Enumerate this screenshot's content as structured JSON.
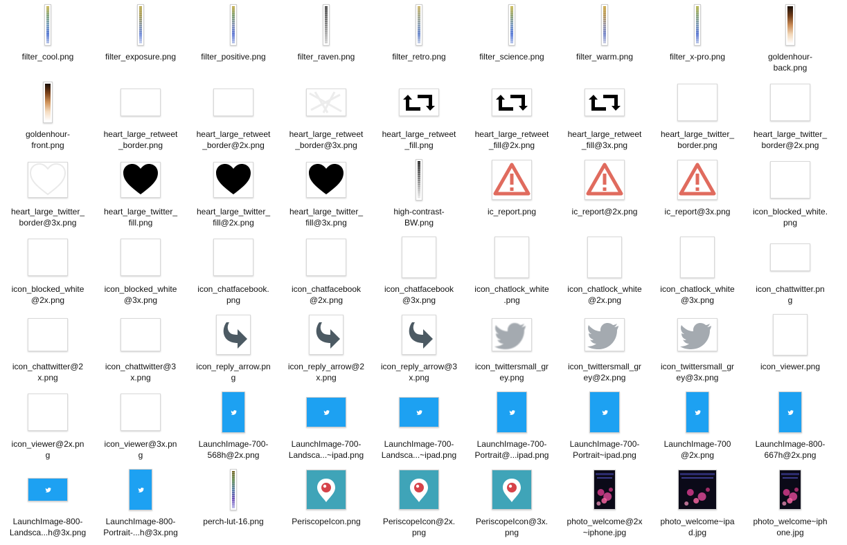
{
  "files": [
    {
      "name": "filter_cool.png",
      "kind": "strip",
      "colors": [
        "#c9b24a",
        "#7fa37a",
        "#7a9fc0",
        "#4a6fd0",
        "#b6c4e6"
      ]
    },
    {
      "name": "filter_exposure.png",
      "kind": "strip",
      "colors": [
        "#b8a64a",
        "#a69a55",
        "#8c9aa5",
        "#6a86d8",
        "#c6d1ee"
      ]
    },
    {
      "name": "filter_positive.png",
      "kind": "strip",
      "colors": [
        "#c2a640",
        "#7a9d6e",
        "#8a96b8",
        "#5670d2",
        "#b9c6e9"
      ]
    },
    {
      "name": "filter_raven.png",
      "kind": "strip",
      "colors": [
        "#444444",
        "#666666",
        "#888888",
        "#aaaaaa",
        "#d2d2d2"
      ]
    },
    {
      "name": "filter_retro.png",
      "kind": "strip",
      "colors": [
        "#c8b060",
        "#a4a78a",
        "#8fa2b6",
        "#6080c9",
        "#c9d3e7"
      ]
    },
    {
      "name": "filter_science.png",
      "kind": "strip",
      "colors": [
        "#c7b54b",
        "#8ea272",
        "#7d9bc2",
        "#4e72d6",
        "#b7c6ea"
      ]
    },
    {
      "name": "filter_warm.png",
      "kind": "strip",
      "colors": [
        "#c9a33e",
        "#b59455",
        "#9c98a8",
        "#6e7fc6",
        "#cbcfe2"
      ]
    },
    {
      "name": "filter_x-pro.png",
      "kind": "strip",
      "colors": [
        "#b2b040",
        "#86a27a",
        "#7e9ab8",
        "#506fd0",
        "#bac6e7"
      ]
    },
    {
      "name": "goldenhour-\nback.png",
      "kind": "goldstrip",
      "colors": [
        "#1a0f08",
        "#6d3a18",
        "#c88a55",
        "#f2d7b8",
        "#ffffff"
      ]
    },
    {
      "name": "goldenhour-\nfront.png",
      "kind": "goldstrip",
      "colors": [
        "#1a0f08",
        "#7a4119",
        "#d0935a",
        "#f5dcc0",
        "#ffffff"
      ]
    },
    {
      "name": "heart_large_retweet\n_border.png",
      "kind": "blank-wide"
    },
    {
      "name": "heart_large_retweet\n_border@2x.png",
      "kind": "blank-wide"
    },
    {
      "name": "heart_large_retweet\n_border@3x.png",
      "kind": "faint-wide"
    },
    {
      "name": "heart_large_retweet\n_fill.png",
      "kind": "retweet"
    },
    {
      "name": "heart_large_retweet\n_fill@2x.png",
      "kind": "retweet"
    },
    {
      "name": "heart_large_retweet\n_fill@3x.png",
      "kind": "retweet"
    },
    {
      "name": "heart_large_twitter_\nborder.png",
      "kind": "blank-square"
    },
    {
      "name": "heart_large_twitter_\nborder@2x.png",
      "kind": "blank-square"
    },
    {
      "name": "heart_large_twitter_\nborder@3x.png",
      "kind": "heart-outline"
    },
    {
      "name": "heart_large_twitter_\nfill.png",
      "kind": "heart"
    },
    {
      "name": "heart_large_twitter_\nfill@2x.png",
      "kind": "heart"
    },
    {
      "name": "heart_large_twitter_\nfill@3x.png",
      "kind": "heart"
    },
    {
      "name": "high-contrast-\nBW.png",
      "kind": "strip",
      "colors": [
        "#222222",
        "#555555",
        "#888888",
        "#bbbbbb",
        "#eeeeee"
      ]
    },
    {
      "name": "ic_report.png",
      "kind": "warning"
    },
    {
      "name": "ic_report@2x.png",
      "kind": "warning"
    },
    {
      "name": "ic_report@3x.png",
      "kind": "warning"
    },
    {
      "name": "icon_blocked_white.\npng",
      "kind": "blank-square"
    },
    {
      "name": "icon_blocked_white\n@2x.png",
      "kind": "blank-square"
    },
    {
      "name": "icon_blocked_white\n@3x.png",
      "kind": "blank-square"
    },
    {
      "name": "icon_chatfacebook.\npng",
      "kind": "blank-square"
    },
    {
      "name": "icon_chatfacebook\n@2x.png",
      "kind": "blank-square"
    },
    {
      "name": "icon_chatfacebook\n@3x.png",
      "kind": "blank-tall"
    },
    {
      "name": "icon_chatlock_white\n.png",
      "kind": "blank-tall"
    },
    {
      "name": "icon_chatlock_white\n@2x.png",
      "kind": "blank-tall"
    },
    {
      "name": "icon_chatlock_white\n@3x.png",
      "kind": "blank-tall"
    },
    {
      "name": "icon_chattwitter.pn\ng",
      "kind": "blank-wide"
    },
    {
      "name": "icon_chattwitter@2\nx.png",
      "kind": "blank-square-sm"
    },
    {
      "name": "icon_chattwitter@3\nx.png",
      "kind": "blank-square-sm"
    },
    {
      "name": "icon_reply_arrow.pn\ng",
      "kind": "reply"
    },
    {
      "name": "icon_reply_arrow@2\nx.png",
      "kind": "reply"
    },
    {
      "name": "icon_reply_arrow@3\nx.png",
      "kind": "reply"
    },
    {
      "name": "icon_twittersmall_gr\ney.png",
      "kind": "bird-pixel"
    },
    {
      "name": "icon_twittersmall_gr\ney@2x.png",
      "kind": "bird"
    },
    {
      "name": "icon_twittersmall_gr\ney@3x.png",
      "kind": "bird"
    },
    {
      "name": "icon_viewer.png",
      "kind": "blank-tall"
    },
    {
      "name": "icon_viewer@2x.pn\ng",
      "kind": "blank-square"
    },
    {
      "name": "icon_viewer@3x.pn\ng",
      "kind": "blank-square"
    },
    {
      "name": "LaunchImage-700-\n568h@2x.png",
      "kind": "launch-tall"
    },
    {
      "name": "LaunchImage-700-\nLandsca...~ipad.png",
      "kind": "launch-wide"
    },
    {
      "name": "LaunchImage-700-\nLandsca...~ipad.png",
      "kind": "launch-wide"
    },
    {
      "name": "LaunchImage-700-\nPortrait@...ipad.png",
      "kind": "launch-portrait"
    },
    {
      "name": "LaunchImage-700-\nPortrait~ipad.png",
      "kind": "launch-portrait"
    },
    {
      "name": "LaunchImage-700\n@2x.png",
      "kind": "launch-tall"
    },
    {
      "name": "LaunchImage-800-\n667h@2x.png",
      "kind": "launch-tall"
    },
    {
      "name": "LaunchImage-800-\nLandsca...h@3x.png",
      "kind": "launch-wide-sm"
    },
    {
      "name": "LaunchImage-800-\nPortrait-...h@3x.png",
      "kind": "launch-tall"
    },
    {
      "name": "perch-lut-16.png",
      "kind": "strip",
      "colors": [
        "#7a6a2a",
        "#5f8a52",
        "#5a7fa8",
        "#6d50b8",
        "#b9b9e9"
      ]
    },
    {
      "name": "PeriscopeIcon.png",
      "kind": "periscope"
    },
    {
      "name": "PeriscopeIcon@2x.\npng",
      "kind": "periscope"
    },
    {
      "name": "PeriscopeIcon@3x.\npng",
      "kind": "periscope"
    },
    {
      "name": "photo_welcome@2x\n~iphone.jpg",
      "kind": "photo-tall"
    },
    {
      "name": "photo_welcome~ipa\nd.jpg",
      "kind": "photo-wide"
    },
    {
      "name": "photo_welcome~iph\none.jpg",
      "kind": "photo-tall"
    }
  ],
  "colors": {
    "twitter_blue": "#1da1f2",
    "report_red": "#e06b5e",
    "reply_grey": "#4c5a63",
    "bird_grey": "#a4aab0",
    "periscope_teal": "#3fa4b8",
    "periscope_red": "#d6434a"
  }
}
